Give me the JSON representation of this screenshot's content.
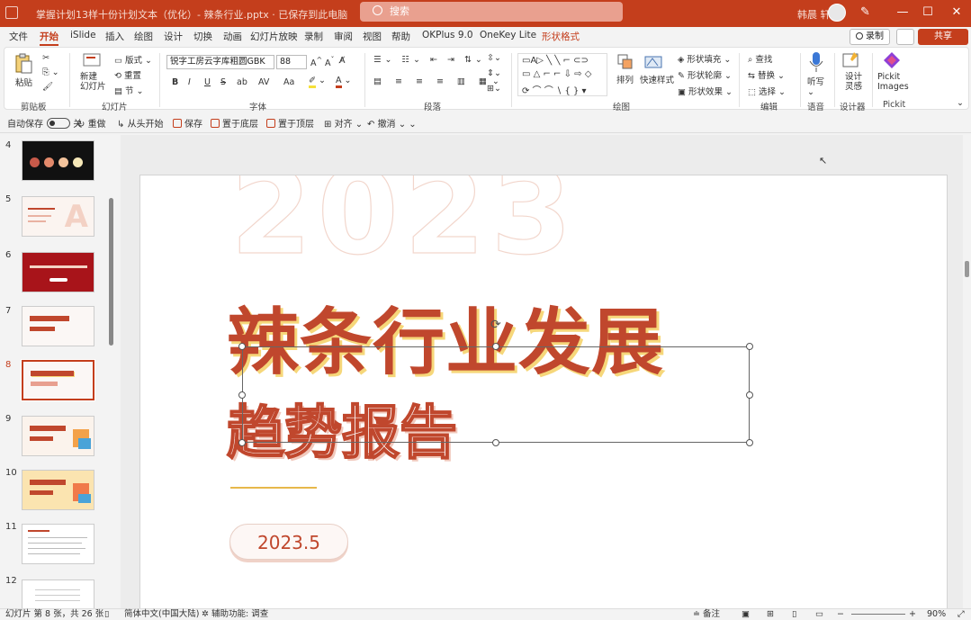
{
  "titlebar": {
    "doc_title": "掌握计划13样十份计划文本（优化）- 辣条行业.pptx  ·  已保存到此电脑",
    "search_placeholder": "搜索",
    "user_name": "韩晨 轩",
    "minimize": "—",
    "maximize": "☐",
    "close": "✕"
  },
  "tabs": [
    "文件",
    "开始",
    "iSlide",
    "插入",
    "绘图",
    "设计",
    "切换",
    "动画",
    "幻灯片放映",
    "录制",
    "审阅",
    "视图",
    "帮助",
    "OKPlus 9.0",
    "OneKey Lite",
    "形状格式"
  ],
  "tab_active": "开始",
  "tab_contextual": "形状格式",
  "record_label": "录制",
  "share_label": "共享",
  "ribbon": {
    "clipboard": {
      "paste": "粘贴",
      "label": "剪贴板"
    },
    "slides": {
      "new_slide": "新建\n幻灯片",
      "layout": "版式",
      "reset": "重置",
      "section": "节",
      "label": "幻灯片"
    },
    "font": {
      "family": "锐字工房云字库粗圆GBK",
      "size": "88",
      "label": "字体",
      "buttons": [
        "B",
        "I",
        "U",
        "S",
        "ab",
        "AV",
        "Aa"
      ]
    },
    "paragraph": {
      "label": "段落"
    },
    "drawing": {
      "label": "绘图",
      "arrange": "排列",
      "quick_styles": "快速样式",
      "fill": "形状填充",
      "outline": "形状轮廓",
      "effects": "形状效果"
    },
    "editing": {
      "find": "查找",
      "replace": "替换",
      "select": "选择",
      "label": "编辑"
    },
    "voice": {
      "dictate": "听写",
      "label": "语音"
    },
    "designer": {
      "btn": "设计\n灵感",
      "label": "设计器"
    },
    "pickit": {
      "btn": "Pickit\nImages",
      "label": "Pickit"
    }
  },
  "quickbar": {
    "autosave_label": "自动保存",
    "autosave_state": "关",
    "items": [
      "重做",
      "从头开始",
      "保存",
      "置于底层",
      "置于顶层",
      "对齐",
      "撤消"
    ]
  },
  "thumbnails": [
    {
      "num": "4",
      "dark_title": "",
      "active": false
    },
    {
      "num": "5",
      "active": false
    },
    {
      "num": "6",
      "active": false
    },
    {
      "num": "7",
      "active": false
    },
    {
      "num": "8",
      "active": true
    },
    {
      "num": "9",
      "active": false
    },
    {
      "num": "10",
      "active": false
    },
    {
      "num": "11",
      "active": false
    },
    {
      "num": "12",
      "active": false
    }
  ],
  "slide": {
    "watermark_year": "2023",
    "title": "辣条行业发展",
    "subtitle": "趋势报告",
    "date": "2023.5"
  },
  "statusbar": {
    "slide_count": "幻灯片 第 8 张，共 26 张",
    "language": "简体中文(中国大陆)",
    "accessibility": "辅助功能: 调查",
    "notes": "备注",
    "zoom": "90%"
  },
  "colors": {
    "accent": "#c43e1c",
    "title_red": "#c0472d",
    "title_shadow": "#f6d77a"
  }
}
